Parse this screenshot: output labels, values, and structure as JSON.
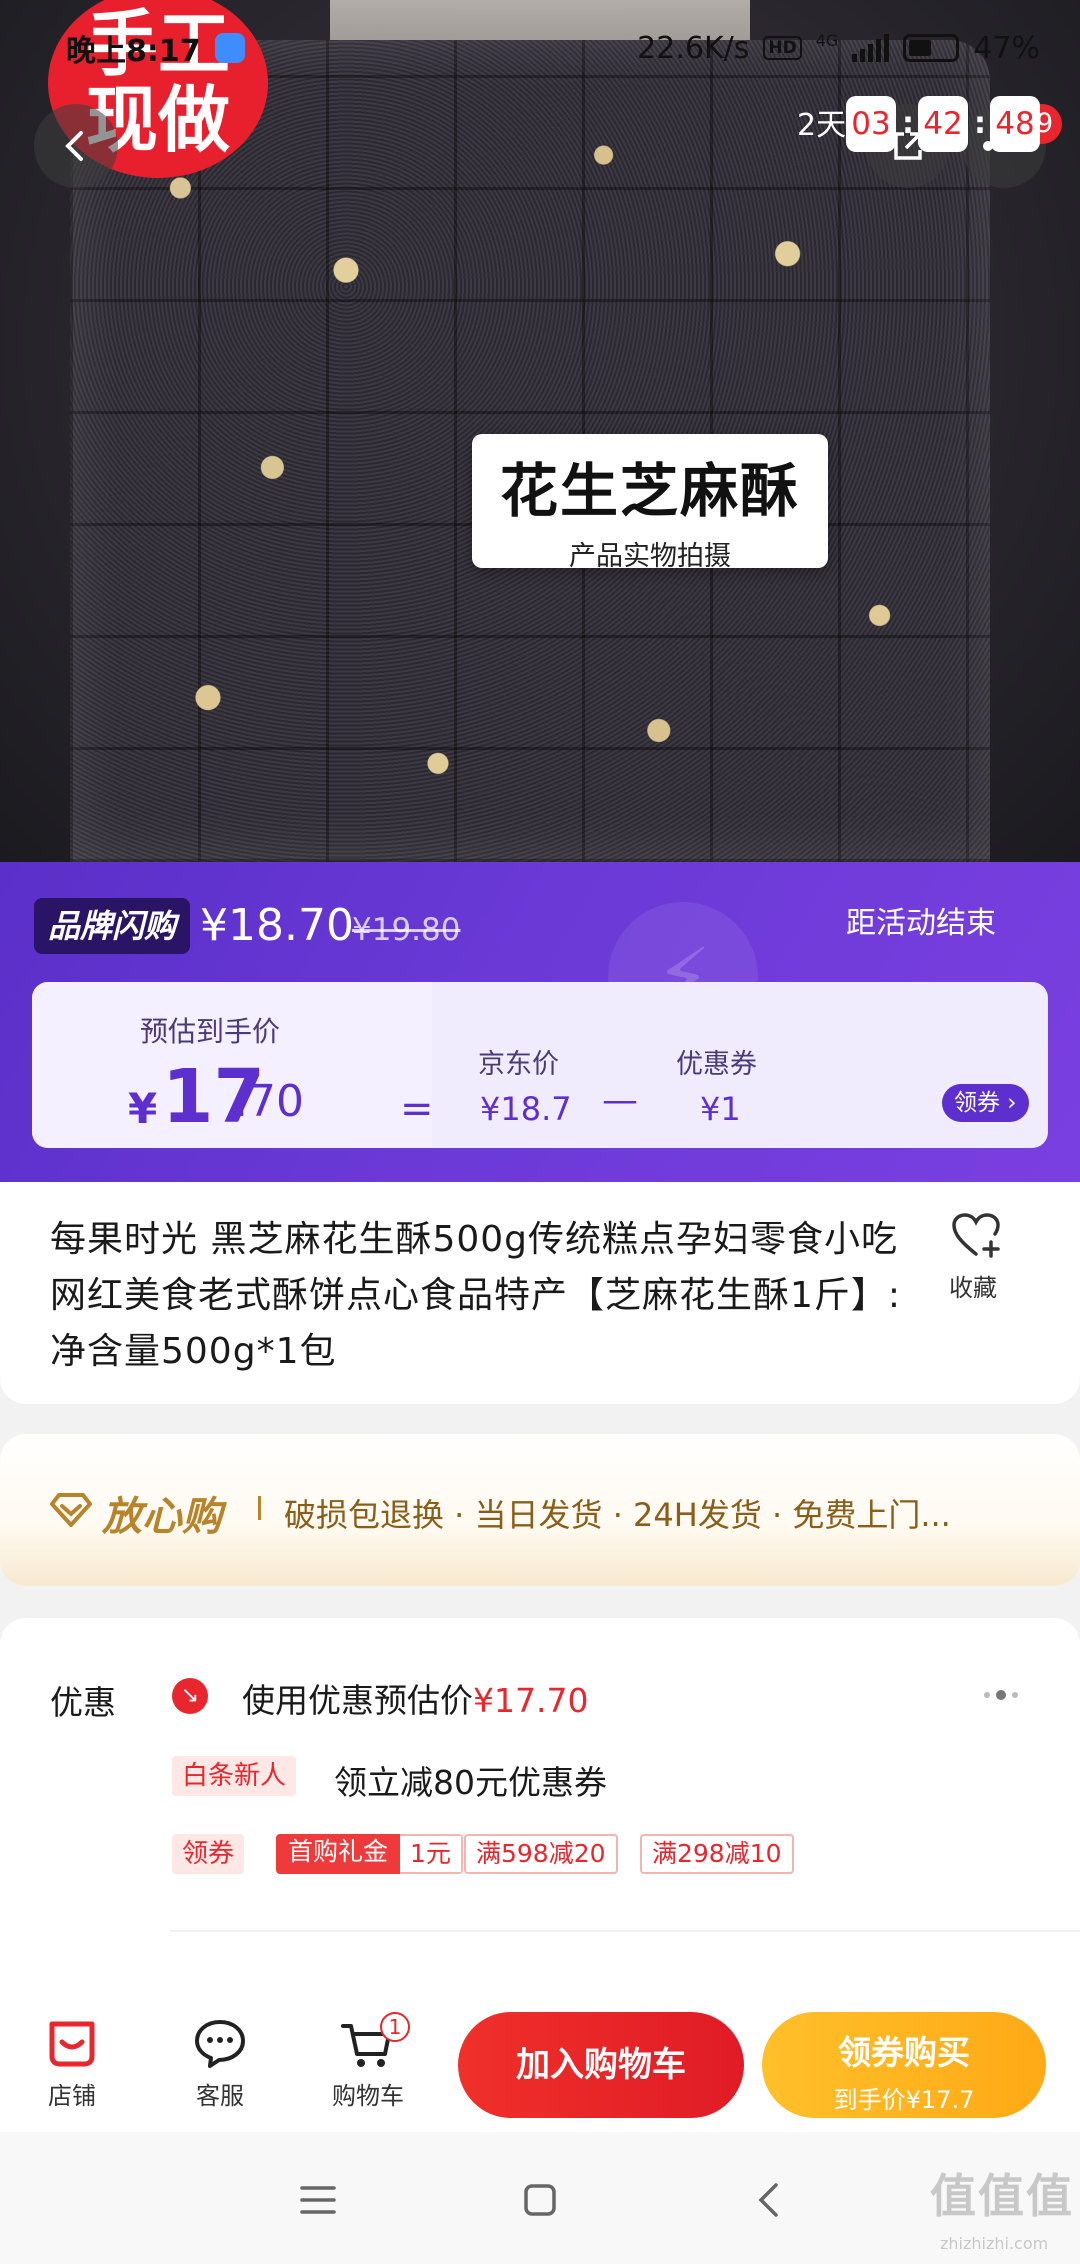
{
  "status_bar": {
    "time": "晚上8:17",
    "net_speed": "22.6K/s",
    "hd": "HD",
    "network": "4G",
    "battery": "47%"
  },
  "hero": {
    "stamp_text": "手工现做",
    "label_title": "花生芝麻酥",
    "label_sub": "产品实物拍摄",
    "message_badge": "99",
    "icons": [
      "back-arrow-icon",
      "share-icon",
      "more-icon"
    ]
  },
  "flash_sale": {
    "brand": "品牌闪购",
    "price": "¥18.70",
    "original_price": "¥19.80",
    "end_label": "距活动结束",
    "days": "2天",
    "countdown": {
      "h": "03",
      "m": "42",
      "s": "48"
    },
    "colors": {
      "panel": "#6a39d6",
      "accent": "#e8262e"
    }
  },
  "estimate": {
    "label": "预估到手价",
    "currency": "¥",
    "price_int": "17",
    "price_dec": ".70",
    "equals": "=",
    "jd_label": "京东价",
    "jd_value": "¥18.7",
    "minus": "—",
    "coupon_label": "优惠券",
    "coupon_value": "¥1",
    "claim": "领券"
  },
  "product": {
    "title": "每果时光 黑芝麻花生酥500g传统糕点孕妇零食小吃网红美食老式酥饼点心食品特产【芝麻花生酥1斤】: 净含量500g*1包",
    "favorite_label": "收藏"
  },
  "assurance": {
    "title": "放心购",
    "text": "破损包退换 · 当日发货 · 24H发货 · 免费上门..."
  },
  "promotions": {
    "label": "优惠",
    "line1_prefix": "使用优惠预估价",
    "line1_price": "¥17.70",
    "line2_tag": "白条新人",
    "line2_text": "领立减80元优惠券",
    "coupon_tag": "领券",
    "coupons": [
      {
        "a": "首购礼金",
        "b": "1元"
      },
      {
        "text": "满598减20"
      },
      {
        "text": "满298减10"
      }
    ]
  },
  "action_bar": {
    "store": "店铺",
    "service": "客服",
    "cart": "购物车",
    "cart_count": "1",
    "add_to_cart": "加入购物车",
    "buy_main": "领券购买",
    "buy_sub": "到手价¥17.7"
  },
  "watermark": {
    "main": "值值值",
    "sub": "zhizhizhi.com"
  }
}
